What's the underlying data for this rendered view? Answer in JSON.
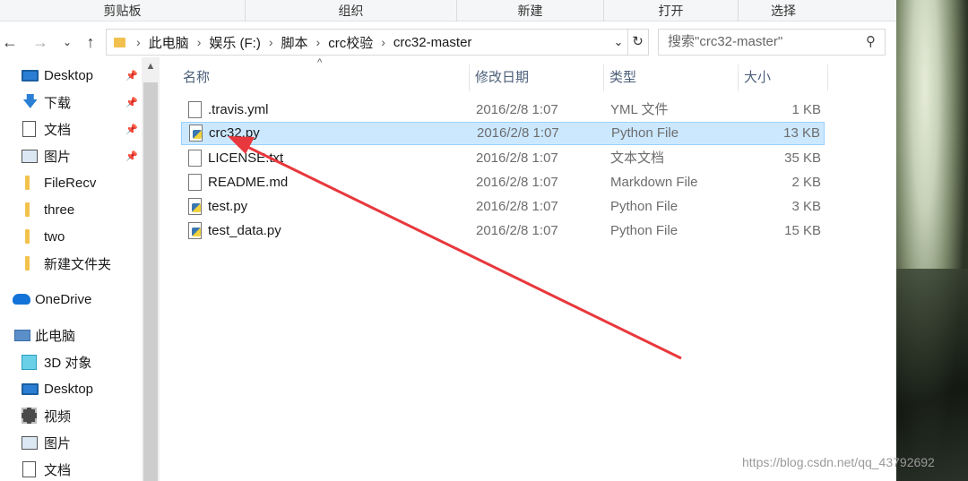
{
  "ribbon": {
    "groups": [
      "剪贴板",
      "组织",
      "新建",
      "打开",
      "选择"
    ]
  },
  "address": {
    "crumbs": [
      "此电脑",
      "娱乐 (F:)",
      "脚本",
      "crc校验",
      "crc32-master"
    ],
    "search_placeholder": "搜索\"crc32-master\""
  },
  "nav": {
    "items": [
      {
        "label": "Desktop",
        "icon": "desktop-icon",
        "pinned": true
      },
      {
        "label": "下载",
        "icon": "download-icon",
        "pinned": true
      },
      {
        "label": "文档",
        "icon": "document-icon",
        "pinned": true
      },
      {
        "label": "图片",
        "icon": "picture-icon",
        "pinned": true
      },
      {
        "label": "FileRecv",
        "icon": "folder-icon",
        "pinned": false
      },
      {
        "label": "three",
        "icon": "folder-icon",
        "pinned": false
      },
      {
        "label": "two",
        "icon": "folder-icon",
        "pinned": false
      },
      {
        "label": "新建文件夹",
        "icon": "folder-icon",
        "pinned": false
      },
      {
        "label": "OneDrive",
        "icon": "onedrive-icon",
        "pinned": false
      },
      {
        "label": "此电脑",
        "icon": "this-pc-icon",
        "pinned": false
      },
      {
        "label": "3D 对象",
        "icon": "3d-objects-icon",
        "pinned": false
      },
      {
        "label": "Desktop",
        "icon": "desktop-icon",
        "pinned": false
      },
      {
        "label": "视频",
        "icon": "video-icon",
        "pinned": false
      },
      {
        "label": "图片",
        "icon": "picture-icon",
        "pinned": false
      },
      {
        "label": "文档",
        "icon": "document-icon",
        "pinned": false
      }
    ]
  },
  "columns": [
    "名称",
    "修改日期",
    "类型",
    "大小"
  ],
  "files": [
    {
      "name": ".travis.yml",
      "date": "2016/2/8 1:07",
      "type": "YML 文件",
      "size": "1 KB",
      "kind": "text",
      "selected": false
    },
    {
      "name": "crc32.py",
      "date": "2016/2/8 1:07",
      "type": "Python File",
      "size": "13 KB",
      "kind": "python",
      "selected": true
    },
    {
      "name": "LICENSE.txt",
      "date": "2016/2/8 1:07",
      "type": "文本文档",
      "size": "35 KB",
      "kind": "text",
      "selected": false
    },
    {
      "name": "README.md",
      "date": "2016/2/8 1:07",
      "type": "Markdown File",
      "size": "2 KB",
      "kind": "text",
      "selected": false
    },
    {
      "name": "test.py",
      "date": "2016/2/8 1:07",
      "type": "Python File",
      "size": "3 KB",
      "kind": "python",
      "selected": false
    },
    {
      "name": "test_data.py",
      "date": "2016/2/8 1:07",
      "type": "Python File",
      "size": "15 KB",
      "kind": "python",
      "selected": false
    }
  ],
  "annotation": {
    "color": "#e8383d"
  },
  "watermark": "https://blog.csdn.net/qq_43792692"
}
